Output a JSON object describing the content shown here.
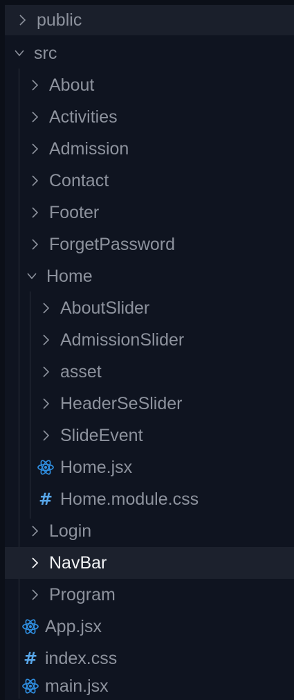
{
  "tree": {
    "public": "public",
    "src": "src",
    "src_children": {
      "about": "About",
      "activities": "Activities",
      "admission": "Admission",
      "contact": "Contact",
      "footer": "Footer",
      "forget_password": "ForgetPassword",
      "home": "Home",
      "home_children": {
        "about_slider": "AboutSlider",
        "admission_slider": "AdmissionSlider",
        "asset": "asset",
        "header_se_slider": "HeaderSeSlider",
        "slide_event": "SlideEvent",
        "home_jsx": "Home.jsx",
        "home_module_css": "Home.module.css"
      },
      "login": "Login",
      "navbar": "NavBar",
      "program": "Program",
      "app_jsx": "App.jsx",
      "index_css": "index.css",
      "main_jsx": "main.jsx"
    }
  },
  "icons": {
    "chevron_right": "chevron-right-icon",
    "chevron_down": "chevron-down-icon",
    "react": "react-icon",
    "css": "css-hash-icon"
  },
  "colors": {
    "background": "#0f1420",
    "text": "#8d929d",
    "selected_text": "#f2f3f5",
    "selected_background": "#1c212d",
    "react_icon": "#2f8ee0",
    "css_icon": "#58a6e8"
  }
}
